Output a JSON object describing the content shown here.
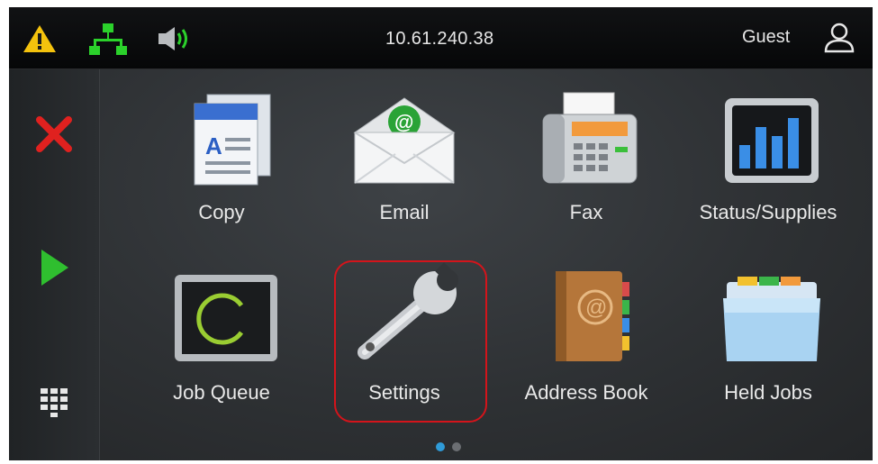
{
  "status_bar": {
    "ip_address": "10.61.240.38",
    "user_label": "Guest",
    "icons": [
      "warning-icon",
      "network-icon",
      "speaker-icon",
      "user-icon"
    ]
  },
  "sidebar": {
    "buttons": [
      "cancel-icon",
      "start-icon",
      "keypad-icon"
    ]
  },
  "apps": [
    {
      "label": "Copy",
      "icon": "copy-icon"
    },
    {
      "label": "Email",
      "icon": "email-icon"
    },
    {
      "label": "Fax",
      "icon": "fax-icon"
    },
    {
      "label": "Status/Supplies",
      "icon": "status-supplies-icon"
    },
    {
      "label": "Job Queue",
      "icon": "job-queue-icon"
    },
    {
      "label": "Settings",
      "icon": "settings-icon"
    },
    {
      "label": "Address Book",
      "icon": "address-book-icon"
    },
    {
      "label": "Held Jobs",
      "icon": "held-jobs-icon"
    }
  ],
  "highlighted_app": "Settings",
  "pagination": {
    "pages": 2,
    "current": 1
  },
  "colors": {
    "warning": "#f4c20d",
    "network": "#2bd12b",
    "cancel": "#e0211f",
    "start": "#2fbf2f",
    "highlight": "#d4141b",
    "dot_active": "#2f9bd8",
    "dot_inactive": "#6b6e72"
  }
}
